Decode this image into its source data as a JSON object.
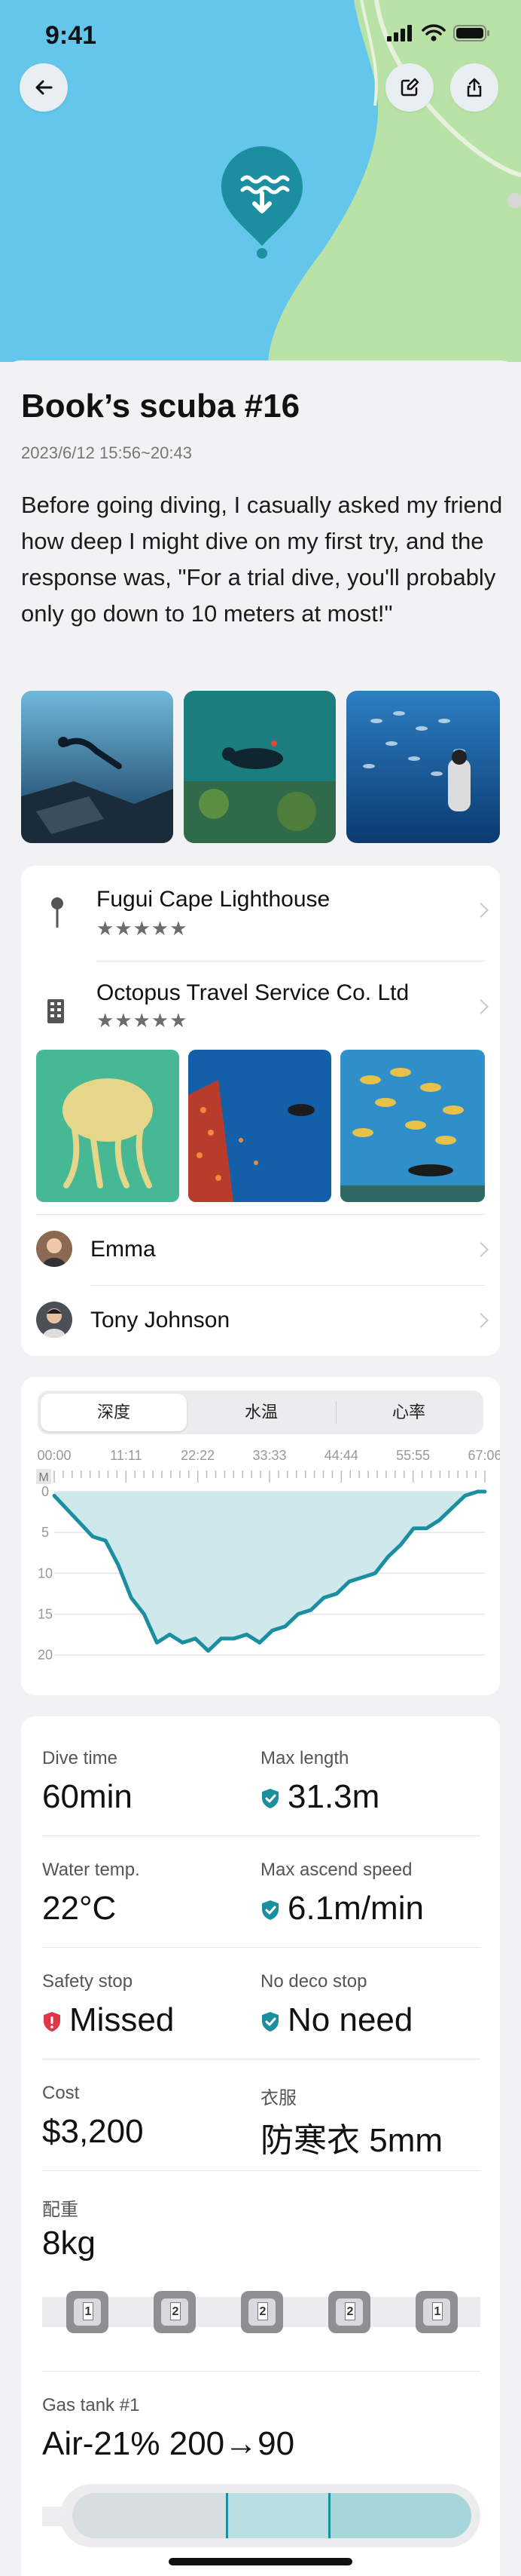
{
  "status_bar": {
    "time": "9:41"
  },
  "header": {
    "title": "Book’s scuba #16",
    "date": "2023/6/12 15:56~20:43",
    "description": "Before going diving, I casually asked my friend how deep I might dive on my first try, and the response was, \"For a trial dive, you'll probably only go down to 10 meters at most!\""
  },
  "places": {
    "site": {
      "name": "Fugui Cape Lighthouse",
      "rating": "★★★★★"
    },
    "shop": {
      "name": "Octopus Travel Service Co. Ltd",
      "rating": "★★★★★"
    }
  },
  "buddies": [
    {
      "name": "Emma"
    },
    {
      "name": "Tony Johnson"
    }
  ],
  "profile": {
    "tabs": [
      "深度",
      "水温",
      "心率"
    ],
    "time_ticks": [
      "00:00",
      "11:11",
      "22:22",
      "33:33",
      "44:44",
      "55:55",
      "67:06"
    ],
    "unit": "M",
    "depth_ticks": [
      "0",
      "5",
      "10",
      "15",
      "20"
    ]
  },
  "chart_data": {
    "type": "area",
    "title": "",
    "xlabel": "",
    "ylabel": "M",
    "x": [
      "00:00",
      "03:00",
      "06:00",
      "08:00",
      "10:00",
      "12:00",
      "14:00",
      "16:00",
      "18:00",
      "20:00",
      "22:00",
      "24:00",
      "26:00",
      "28:00",
      "30:00",
      "32:00",
      "34:00",
      "36:00",
      "38:00",
      "40:00",
      "42:00",
      "44:00",
      "46:00",
      "48:00",
      "50:00",
      "52:00",
      "54:00",
      "56:00",
      "58:00",
      "60:00",
      "62:00",
      "64:00",
      "66:00",
      "67:06"
    ],
    "series": [
      {
        "values": [
          0.5,
          3,
          5.5,
          6,
          9,
          13,
          15,
          18.5,
          17.5,
          18.5,
          18,
          19.5,
          18,
          18,
          17.5,
          18.5,
          17,
          16.5,
          15,
          14.5,
          13,
          12.5,
          11,
          10.5,
          10,
          8,
          6.5,
          4.5,
          4.5,
          3.5,
          2,
          0.5,
          0,
          0
        ]
      }
    ],
    "ylim": [
      20.5,
      0
    ],
    "grid": true,
    "color": "#1b8fa0"
  },
  "stats": {
    "dive_time": {
      "label": "Dive time",
      "value": "60min"
    },
    "max_length": {
      "label": "Max length",
      "value": "31.3m"
    },
    "water_temp": {
      "label": "Water temp.",
      "value": "22°C"
    },
    "max_ascend": {
      "label": "Max ascend speed",
      "value": "6.1m/min"
    },
    "safety_stop": {
      "label": "Safety stop",
      "value": "Missed"
    },
    "no_deco": {
      "label": "No deco stop",
      "value": "No need"
    },
    "cost": {
      "label": "Cost",
      "value": "$3,200"
    },
    "clothes": {
      "label": "衣服",
      "value": "防寒衣 5mm"
    },
    "weight": {
      "label": "配重",
      "value": "8kg",
      "blocks": [
        "1",
        "2",
        "2",
        "2",
        "1"
      ]
    },
    "gas": {
      "label": "Gas tank #1",
      "value": "Air-21% 200→90"
    }
  },
  "colors": {
    "accent": "#1b8fa0",
    "warning": "#e0364a",
    "map_water": "#63c6ea",
    "map_land": "#b9e3a6"
  }
}
